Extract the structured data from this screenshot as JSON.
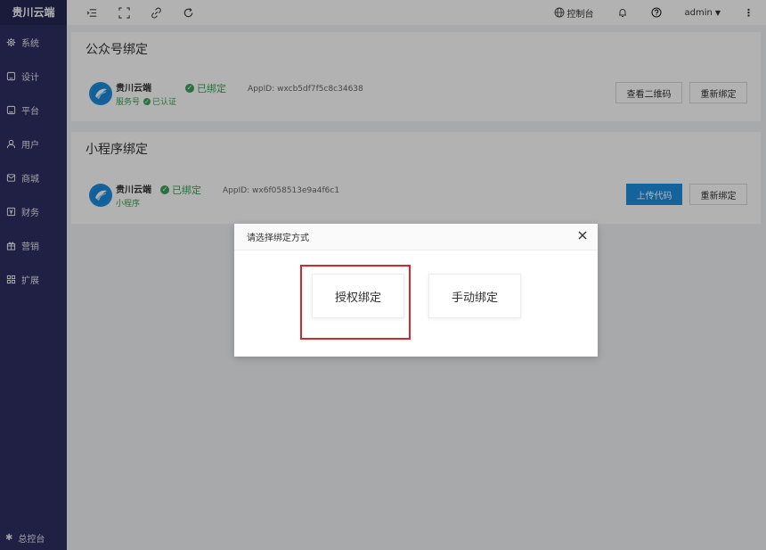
{
  "brand": "贵川云端",
  "sidebar": {
    "items": [
      {
        "label": "系统",
        "icon": "gear-icon"
      },
      {
        "label": "设计",
        "icon": "design-icon"
      },
      {
        "label": "平台",
        "icon": "platform-icon"
      },
      {
        "label": "用户",
        "icon": "user-icon"
      },
      {
        "label": "商城",
        "icon": "mail-icon"
      },
      {
        "label": "财务",
        "icon": "finance-icon"
      },
      {
        "label": "营销",
        "icon": "gift-icon"
      },
      {
        "label": "扩展",
        "icon": "grid-icon"
      }
    ],
    "footer": {
      "label": "总控台",
      "icon": "gear-icon"
    }
  },
  "topbar": {
    "icons": [
      "menu-fold-icon",
      "fullscreen-icon",
      "link-icon",
      "refresh-icon"
    ],
    "console_label": "控制台",
    "user_label": "admin"
  },
  "official": {
    "title": "公众号绑定",
    "name": "贵川云端",
    "type": "服务号",
    "verified": "已认证",
    "status": "已绑定",
    "appid": "AppID:  wxcb5df7f5c8c34638",
    "btn_qrcode": "查看二维码",
    "btn_rebind": "重新绑定"
  },
  "mini": {
    "title": "小程序绑定",
    "name": "贵川云端",
    "type": "小程序",
    "status": "已绑定",
    "appid": "AppID:  wx6f058513e9a4f6c1",
    "btn_upload": "上传代码",
    "btn_rebind": "重新绑定"
  },
  "modal": {
    "title": "请选择绑定方式",
    "option_auth": "授权绑定",
    "option_manual": "手动绑定"
  },
  "colors": {
    "sidebar": "#2e2e62",
    "primary": "#1f8fe0",
    "success": "#3aa25b",
    "highlight": "#d22a2a"
  }
}
